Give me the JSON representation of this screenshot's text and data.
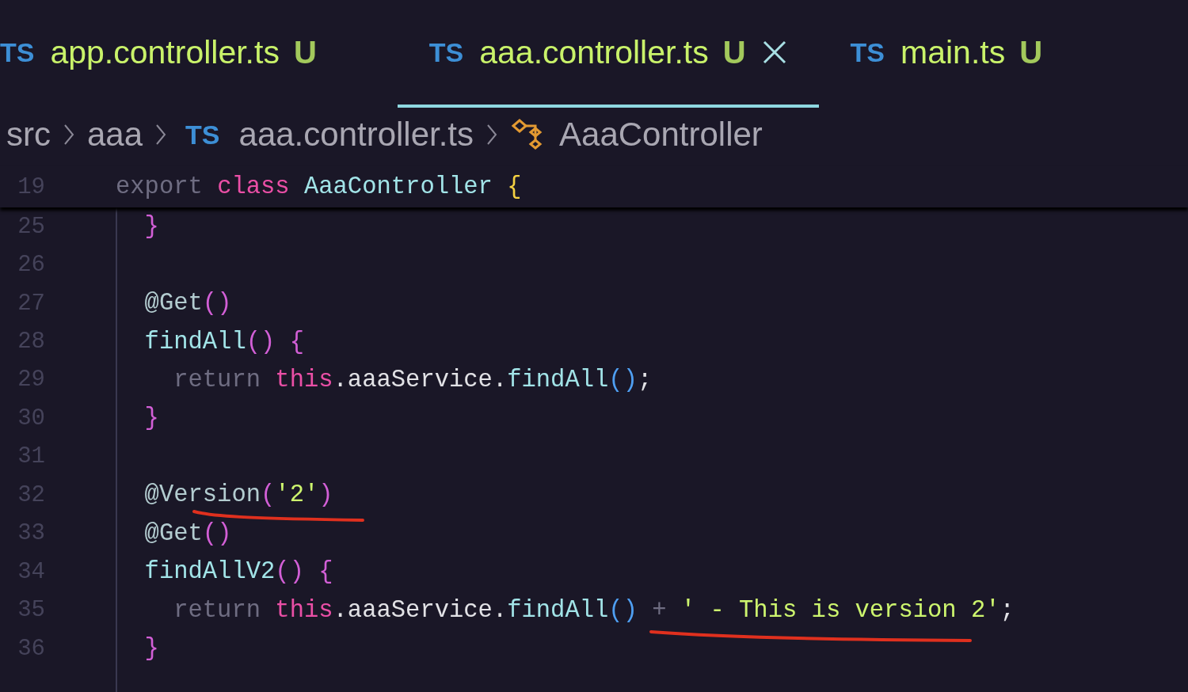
{
  "tabs": [
    {
      "icon": "TS",
      "label": "app.controller.ts",
      "status": "U",
      "selected": false
    },
    {
      "icon": "TS",
      "label": "aaa.controller.ts",
      "status": "U",
      "selected": true
    },
    {
      "icon": "TS",
      "label": "main.ts",
      "status": "U",
      "selected": false
    }
  ],
  "breadcrumb": [
    {
      "kind": "folder",
      "text": "src"
    },
    {
      "kind": "folder",
      "text": "aaa"
    },
    {
      "kind": "file",
      "icon": "TS",
      "text": "aaa.controller.ts"
    },
    {
      "kind": "class",
      "text": "AaaController"
    }
  ],
  "sticky_line": {
    "number": "19",
    "tokens": [
      {
        "kind": "kw",
        "text": "export "
      },
      {
        "kind": "storage",
        "text": "class "
      },
      {
        "kind": "type",
        "text": "AaaController "
      },
      {
        "kind": "b3",
        "text": "{"
      }
    ]
  },
  "lines": [
    {
      "number": "25",
      "tokens": [
        {
          "kind": "b1",
          "text": "  }"
        }
      ]
    },
    {
      "number": "26"
    },
    {
      "number": "27",
      "tokens": [
        {
          "kind": "deco",
          "text": "  @Get"
        },
        {
          "kind": "b1",
          "text": "()"
        }
      ]
    },
    {
      "number": "28",
      "tokens": [
        {
          "kind": "fn",
          "text": "  findAll"
        },
        {
          "kind": "b1",
          "text": "() {"
        }
      ]
    },
    {
      "number": "29",
      "tokens": [
        {
          "kind": "kw",
          "text": "    return "
        },
        {
          "kind": "storage",
          "text": "this"
        },
        {
          "kind": "plain",
          "text": ".aaaService."
        },
        {
          "kind": "fn",
          "text": "findAll"
        },
        {
          "kind": "b2",
          "text": "()"
        },
        {
          "kind": "plain",
          "text": ";"
        }
      ]
    },
    {
      "number": "30",
      "tokens": [
        {
          "kind": "b1",
          "text": "  }"
        }
      ]
    },
    {
      "number": "31"
    },
    {
      "number": "32",
      "tokens": [
        {
          "kind": "deco",
          "text": "  @Version"
        },
        {
          "kind": "b1",
          "text": "("
        },
        {
          "kind": "str",
          "text": "'2'"
        },
        {
          "kind": "b1",
          "text": ")"
        }
      ]
    },
    {
      "number": "33",
      "tokens": [
        {
          "kind": "deco",
          "text": "  @Get"
        },
        {
          "kind": "b1",
          "text": "()"
        }
      ]
    },
    {
      "number": "34",
      "tokens": [
        {
          "kind": "fn",
          "text": "  findAllV2"
        },
        {
          "kind": "b1",
          "text": "() {"
        }
      ]
    },
    {
      "number": "35",
      "tokens": [
        {
          "kind": "kw",
          "text": "    return "
        },
        {
          "kind": "storage",
          "text": "this"
        },
        {
          "kind": "plain",
          "text": ".aaaService."
        },
        {
          "kind": "fn",
          "text": "findAll"
        },
        {
          "kind": "b2",
          "text": "()"
        },
        {
          "kind": "op",
          "text": " + "
        },
        {
          "kind": "str",
          "text": "' - This is version 2'"
        },
        {
          "kind": "plain",
          "text": ";"
        }
      ]
    },
    {
      "number": "36",
      "tokens": [
        {
          "kind": "b1",
          "text": "  }"
        }
      ]
    }
  ]
}
